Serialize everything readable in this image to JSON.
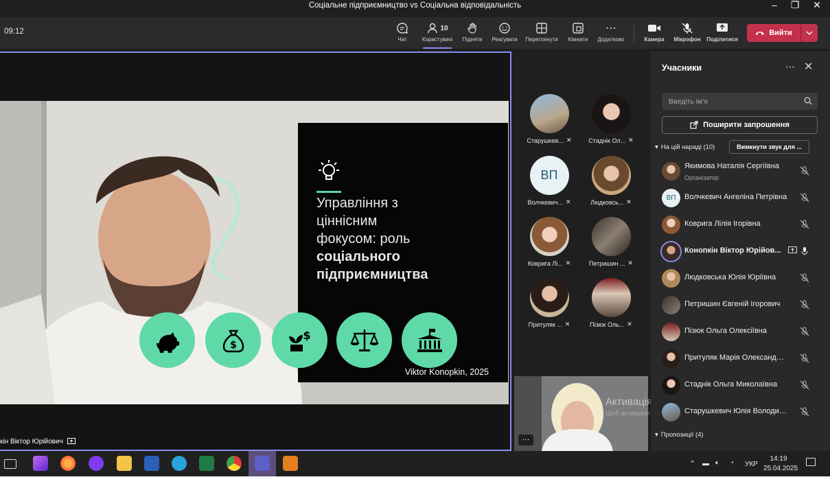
{
  "window": {
    "title": "Соціальне підприємництво vs Соціальна відповідальність"
  },
  "toolbar": {
    "timer": "09:12",
    "buttons": [
      {
        "label": "Чат",
        "icon": "chat-icon"
      },
      {
        "label": "Користувачі",
        "icon": "people-icon",
        "count": "10"
      },
      {
        "label": "Підняти",
        "icon": "raise-hand-icon"
      },
      {
        "label": "Реагувати",
        "icon": "emoji-icon"
      },
      {
        "label": "Переглянути",
        "icon": "view-icon"
      },
      {
        "label": "Кімнати",
        "icon": "rooms-icon"
      },
      {
        "label": "Додатково",
        "icon": "more-icon"
      },
      {
        "label": "Камера",
        "icon": "camera-icon"
      },
      {
        "label": "Мікрофон",
        "icon": "mic-off-icon"
      },
      {
        "label": "Поділитися",
        "icon": "share-icon"
      }
    ],
    "leave_label": "Вийти",
    "leave_color": "#c4314b"
  },
  "stage": {
    "slide_title_line1": "Управління з",
    "slide_title_line2": "ціннісним",
    "slide_title_line3": "фокусом: роль",
    "slide_title_bold1": "соціального",
    "slide_title_bold2": "підприємництва",
    "slide_author": "Viktor Konopkin, 2025",
    "speaker_name": "кін Віктор Юрійович",
    "accent_color": "#5fd9a7"
  },
  "gallery": {
    "tiles": [
      {
        "name": "Старушкев..."
      },
      {
        "name": "Стаднік Ол..."
      },
      {
        "name": "Волчкевич...",
        "initials": "ВП"
      },
      {
        "name": "Людковсь..."
      },
      {
        "name": "Коврига Лі..."
      },
      {
        "name": "Петришин ..."
      },
      {
        "name": "Притуляк ..."
      },
      {
        "name": "Пізюк Оль..."
      }
    ]
  },
  "participants": {
    "title": "Учасники",
    "search_placeholder": "Введіть ім'я",
    "share_invite": "Поширити запрошення",
    "in_meeting_label": "На цій нараді (10)",
    "mute_all": "Вимкнути звук для ...",
    "suggestions_label": "Пропозиції (4)",
    "list": [
      {
        "name": "Якимова Наталія Сергіївна",
        "role": "Організатор"
      },
      {
        "name": "Волчкевич Ангеліна Петрівна",
        "initials": "ВП"
      },
      {
        "name": "Коврига Лілія Ігорівна"
      },
      {
        "name": "Конопкін Віктор Юрійов..."
      },
      {
        "name": "Людковська Юлія Юріївна"
      },
      {
        "name": "Петришин Євгеній Ігорович"
      },
      {
        "name": "Пізюк Ольга Олексіївна"
      },
      {
        "name": "Притуляк Марія Олександрів..."
      },
      {
        "name": "Стаднік Ольга Миколаївна"
      },
      {
        "name": "Старушкевич Юлія Володим..."
      }
    ]
  },
  "watermark": {
    "line1": "Активація Windows",
    "line2": "Щоб активувати Windows, перейдіть у розділ"
  },
  "taskbar": {
    "lang": "УКР",
    "time": "14:19",
    "date": "25.04.2025"
  }
}
